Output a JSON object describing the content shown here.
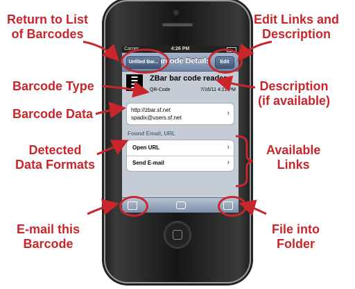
{
  "callouts": {
    "return_list": "Return to List\nof Barcodes",
    "edit_links": "Edit Links and\nDescription",
    "barcode_type": "Barcode Type",
    "description": "Description\n(if available)",
    "barcode_data": "Barcode Data",
    "detected_formats": "Detected\nData Formats",
    "available_links": "Available\nLinks",
    "email_barcode": "E-mail this\nBarcode",
    "file_folder": "File into\nFolder"
  },
  "phone": {
    "status": {
      "carrier": "Carrier",
      "time": "4:26 PM"
    },
    "nav": {
      "title": "Barcode Details",
      "back_label": "Unfiled Bar...",
      "edit_label": "Edit"
    },
    "header": {
      "title": "ZBar bar code reader",
      "type": "QR-Code",
      "date": "7/16/11 4:21 PM"
    },
    "data_lines": [
      "http://zbar.sf.net",
      "spadix@users.sf.net"
    ],
    "section_label": "Found Email, URL",
    "links": [
      {
        "label": "Open URL"
      },
      {
        "label": "Send E-mail"
      }
    ]
  },
  "icons": {
    "toolbar": [
      "compose-icon",
      "camera-icon",
      "folder-icon"
    ]
  },
  "colors": {
    "accent": "#c8262b",
    "navbar": "#6f86a6",
    "screen_bg": "#c5ccd6"
  }
}
